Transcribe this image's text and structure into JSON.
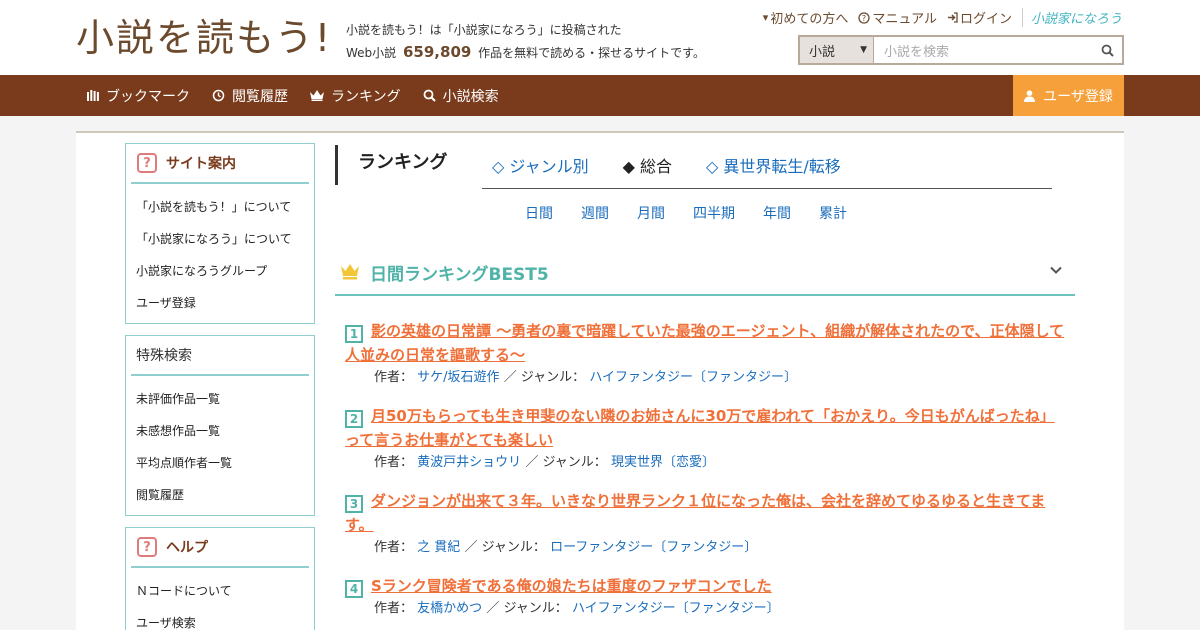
{
  "header": {
    "logo_text": "小説を読もう!",
    "tagline_line1": "小説を読もう！は「小説家になろう」に投稿された",
    "tagline_prefix": "Web小説",
    "tagline_count": "659,809",
    "tagline_suffix": "作品を無料で読める・探せるサイトです。",
    "top_links": {
      "beginners": "初めての方へ",
      "manual": "マニュアル",
      "login": "ログイン",
      "narou": "小説家になろう"
    },
    "search": {
      "category": "小説",
      "placeholder": "小説を検索"
    }
  },
  "nav": {
    "bookmark": "ブックマーク",
    "history": "閲覧履歴",
    "ranking": "ランキング",
    "search": "小説検索",
    "register": "ユーザ登録"
  },
  "sidebar": {
    "site_guide": {
      "title": "サイト案内",
      "items": [
        "「小説を読もう！」について",
        "「小説家になろう」について",
        "小説家になろうグループ",
        "ユーザ登録"
      ]
    },
    "special_search": {
      "title": "特殊検索",
      "items": [
        "未評価作品一覧",
        "未感想作品一覧",
        "平均点順作者一覧",
        "閲覧履歴"
      ]
    },
    "help": {
      "title": "ヘルプ",
      "items": [
        "Ｎコードについて",
        "ユーザ検索"
      ]
    }
  },
  "ranking": {
    "title": "ランキング",
    "tabs": [
      "◇ ジャンル別",
      "◆ 総合",
      "◇ 異世界転生/転移"
    ],
    "periods": [
      "日間",
      "週間",
      "月間",
      "四半期",
      "年間",
      "累計"
    ],
    "best_title": "日間ランキングBEST5",
    "author_label": "作者：",
    "genre_label": "／ ジャンル：",
    "entries": [
      {
        "rank": "1",
        "title": "影の英雄の日常譚 ～勇者の裏で暗躍していた最強のエージェント、組織が解体されたので、正体隠して人並みの日常を謳歌する～",
        "author": "サケ/坂石遊作",
        "genre": "ハイファンタジー〔ファンタジー〕"
      },
      {
        "rank": "2",
        "title": "月50万もらっても生き甲斐のない隣のお姉さんに30万で雇われて「おかえり。今日もがんばったね」って言うお仕事がとても楽しい",
        "author": "黄波戸井ショウリ",
        "genre": "現実世界〔恋愛〕"
      },
      {
        "rank": "3",
        "title": "ダンジョンが出来て３年。いきなり世界ランク１位になった俺は、会社を辞めてゆるゆると生きてます。",
        "author": "之 貫紀",
        "genre": "ローファンタジー〔ファンタジー〕"
      },
      {
        "rank": "4",
        "title": "Sランク冒険者である俺の娘たちは重度のファザコンでした",
        "author": "友橋かめつ",
        "genre": "ハイファンタジー〔ファンタジー〕"
      }
    ]
  },
  "colors": {
    "brand_brown": "#7a3b1c",
    "accent_orange": "#f6a03b",
    "link_blue": "#1a6dbd",
    "title_orange": "#f0703a",
    "teal": "#4fb3a8"
  }
}
